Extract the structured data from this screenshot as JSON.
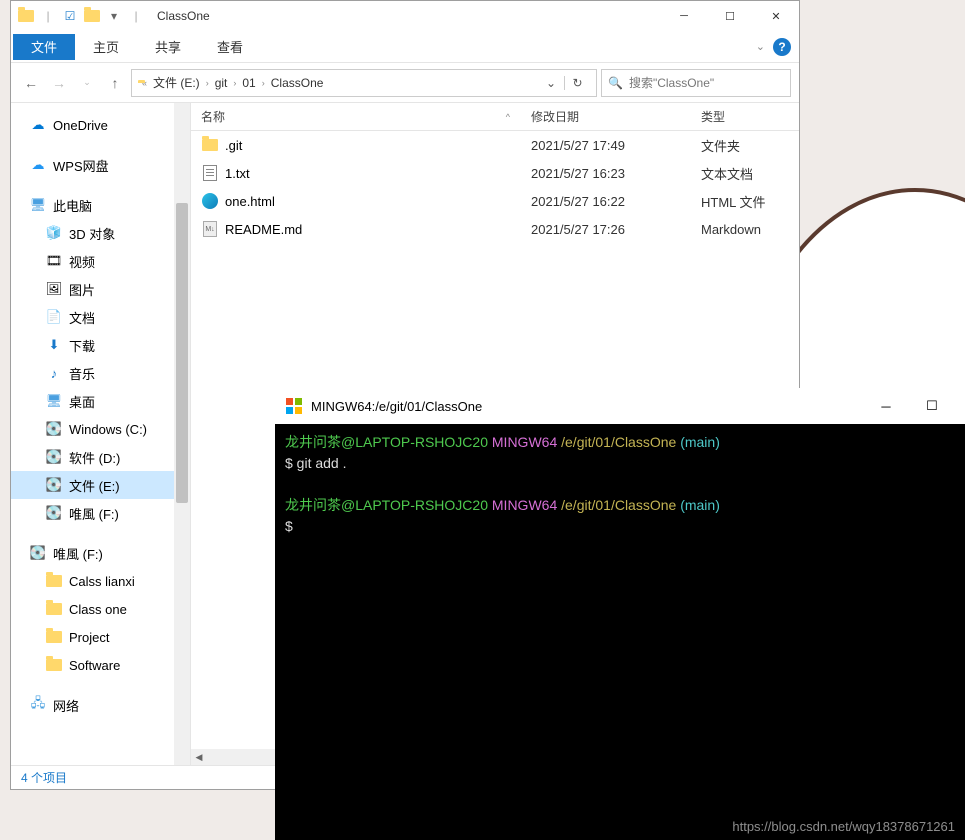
{
  "explorer": {
    "title": "ClassOne",
    "ribbon": {
      "file": "文件",
      "home": "主页",
      "share": "共享",
      "view": "查看"
    },
    "breadcrumb": [
      "文件 (E:)",
      "git",
      "01",
      "ClassOne"
    ],
    "search_placeholder": "搜索\"ClassOne\"",
    "tree": {
      "onedrive": "OneDrive",
      "wps": "WPS网盘",
      "thispc": "此电脑",
      "objects3d": "3D 对象",
      "videos": "视频",
      "pictures": "图片",
      "documents": "文档",
      "downloads": "下载",
      "music": "音乐",
      "desktop": "桌面",
      "winc": "Windows (C:)",
      "softd": "软件 (D:)",
      "filee": "文件 (E:)",
      "weif": "唯風 (F:)",
      "weif2": "唯風 (F:)",
      "calss": "Calss lianxi",
      "classone": "Class one",
      "project": "Project",
      "software": "Software",
      "network": "网络"
    },
    "cols": {
      "name": "名称",
      "date": "修改日期",
      "type": "类型"
    },
    "rows": [
      {
        "name": ".git",
        "date": "2021/5/27 17:49",
        "type": "文件夹",
        "icon": "folder"
      },
      {
        "name": "1.txt",
        "date": "2021/5/27 16:23",
        "type": "文本文档",
        "icon": "txt"
      },
      {
        "name": "one.html",
        "date": "2021/5/27 16:22",
        "type": "HTML 文件",
        "icon": "html"
      },
      {
        "name": "README.md",
        "date": "2021/5/27 17:26",
        "type": "Markdown",
        "icon": "md"
      }
    ],
    "status": "4 个项目"
  },
  "terminal": {
    "title": "MINGW64:/e/git/01/ClassOne",
    "lines": [
      {
        "user": "龙井问茶@LAPTOP-RSHOJC20",
        "host": "MINGW64",
        "path": "/e/git/01/ClassOne",
        "branch": "(main)"
      },
      {
        "cmd": "$ git add ."
      },
      {
        "blank": true
      },
      {
        "user": "龙井问茶@LAPTOP-RSHOJC20",
        "host": "MINGW64",
        "path": "/e/git/01/ClassOne",
        "branch": "(main)"
      },
      {
        "cmd": "$"
      }
    ]
  },
  "watermark": "https://blog.csdn.net/wqy18378671261"
}
